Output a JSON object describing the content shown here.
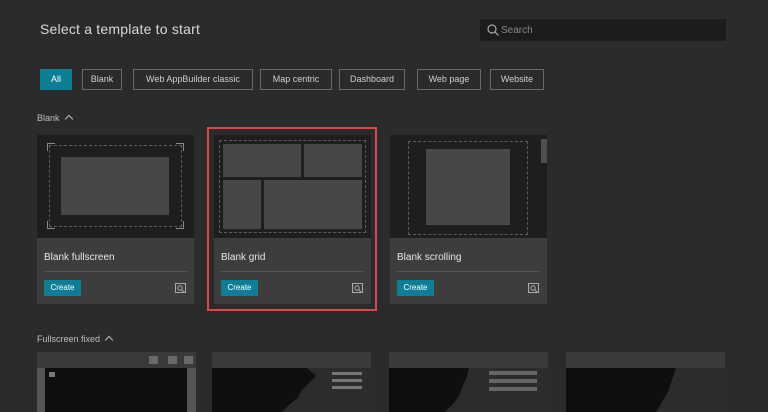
{
  "header": {
    "title": "Select a template to start"
  },
  "search": {
    "placeholder": "Search",
    "icon": "search-icon"
  },
  "filters": [
    {
      "label": "All",
      "active": true
    },
    {
      "label": "Blank",
      "active": false
    },
    {
      "label": "Web AppBuilder classic",
      "active": false
    },
    {
      "label": "Map centric",
      "active": false
    },
    {
      "label": "Dashboard",
      "active": false
    },
    {
      "label": "Web page",
      "active": false
    },
    {
      "label": "Website",
      "active": false
    }
  ],
  "sections": {
    "blank": {
      "label": "Blank"
    },
    "fullscreen_fixed": {
      "label": "Fullscreen fixed"
    }
  },
  "templates": [
    {
      "name": "Blank fullscreen",
      "create_label": "Create",
      "selected": false
    },
    {
      "name": "Blank grid",
      "create_label": "Create",
      "selected": true
    },
    {
      "name": "Blank scrolling",
      "create_label": "Create",
      "selected": false
    }
  ],
  "colors": {
    "accent": "#0e7e96",
    "highlight": "#d9494a",
    "background": "#2b2b2b"
  }
}
